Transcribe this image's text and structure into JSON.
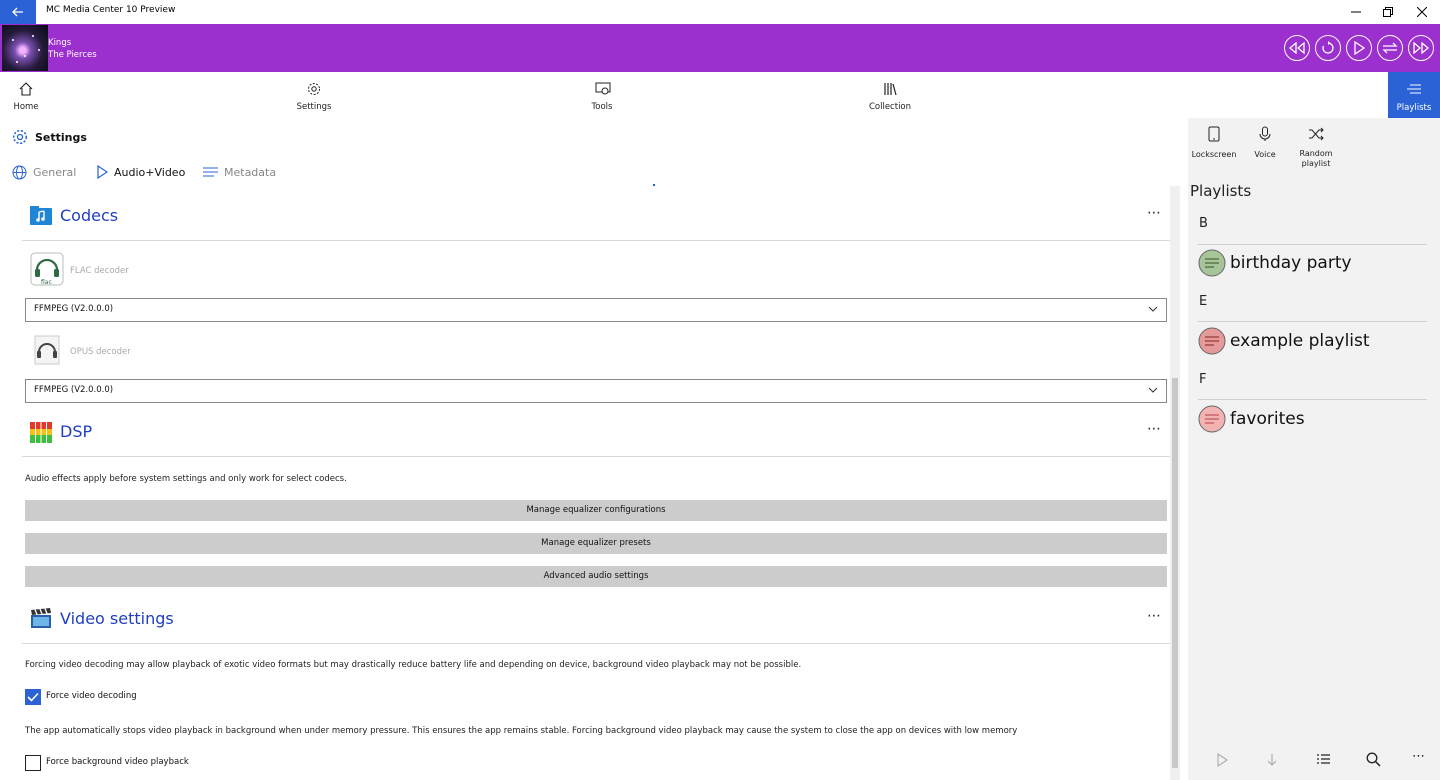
{
  "window": {
    "title": "MC Media Center 10 Preview"
  },
  "now_playing": {
    "title": "Kings",
    "artist": "The Pierces"
  },
  "nav": {
    "home": "Home",
    "settings": "Settings",
    "tools": "Tools",
    "collection": "Collection",
    "playlists": "Playlists"
  },
  "page": {
    "title": "Settings",
    "tabs": [
      "General",
      "Audio+Video",
      "Metadata"
    ]
  },
  "codecs": {
    "title": "Codecs",
    "flac_label": "FLAC decoder",
    "flac_value": "FFMPEG (V2.0.0.0)",
    "opus_label": "OPUS decoder",
    "opus_value": "FFMPEG (V2.0.0.0)"
  },
  "dsp": {
    "title": "DSP",
    "description": "Audio effects apply before system settings and only work for select codecs.",
    "buttons": [
      "Manage equalizer configurations",
      "Manage equalizer presets",
      "Advanced audio settings"
    ]
  },
  "video": {
    "title": "Video settings",
    "desc1": "Forcing video decoding may allow playback of exotic video formats but may drastically reduce battery life and depending on device, background video playback may not be possible.",
    "force_decoding_label": "Force video decoding",
    "force_decoding_checked": true,
    "desc2": "The app automatically stops video playback in background when under memory pressure. This ensures the app remains stable. Forcing background video playback may cause the system to close the app on devices with low memory",
    "force_background_label": "Force background video playback",
    "force_background_checked": false
  },
  "side": {
    "quick_actions": [
      {
        "label": "Lockscreen",
        "icon": "phone-icon"
      },
      {
        "label": "Voice",
        "icon": "microphone-icon"
      },
      {
        "label": "Random playlist",
        "icon": "shuffle-icon"
      }
    ],
    "heading": "Playlists",
    "groups": [
      {
        "letter": "B",
        "items": [
          {
            "name": "birthday party",
            "icon_color": "#a8c49a"
          }
        ]
      },
      {
        "letter": "E",
        "items": [
          {
            "name": "example playlist",
            "icon_color": "#e59a9a"
          }
        ]
      },
      {
        "letter": "F",
        "items": [
          {
            "name": "favorites",
            "icon_color": "#f3b3b3"
          }
        ]
      }
    ]
  },
  "colors": {
    "accent": "#2b62d6",
    "nowbar": "#9b30cf",
    "section_title": "#1f3fbf"
  }
}
